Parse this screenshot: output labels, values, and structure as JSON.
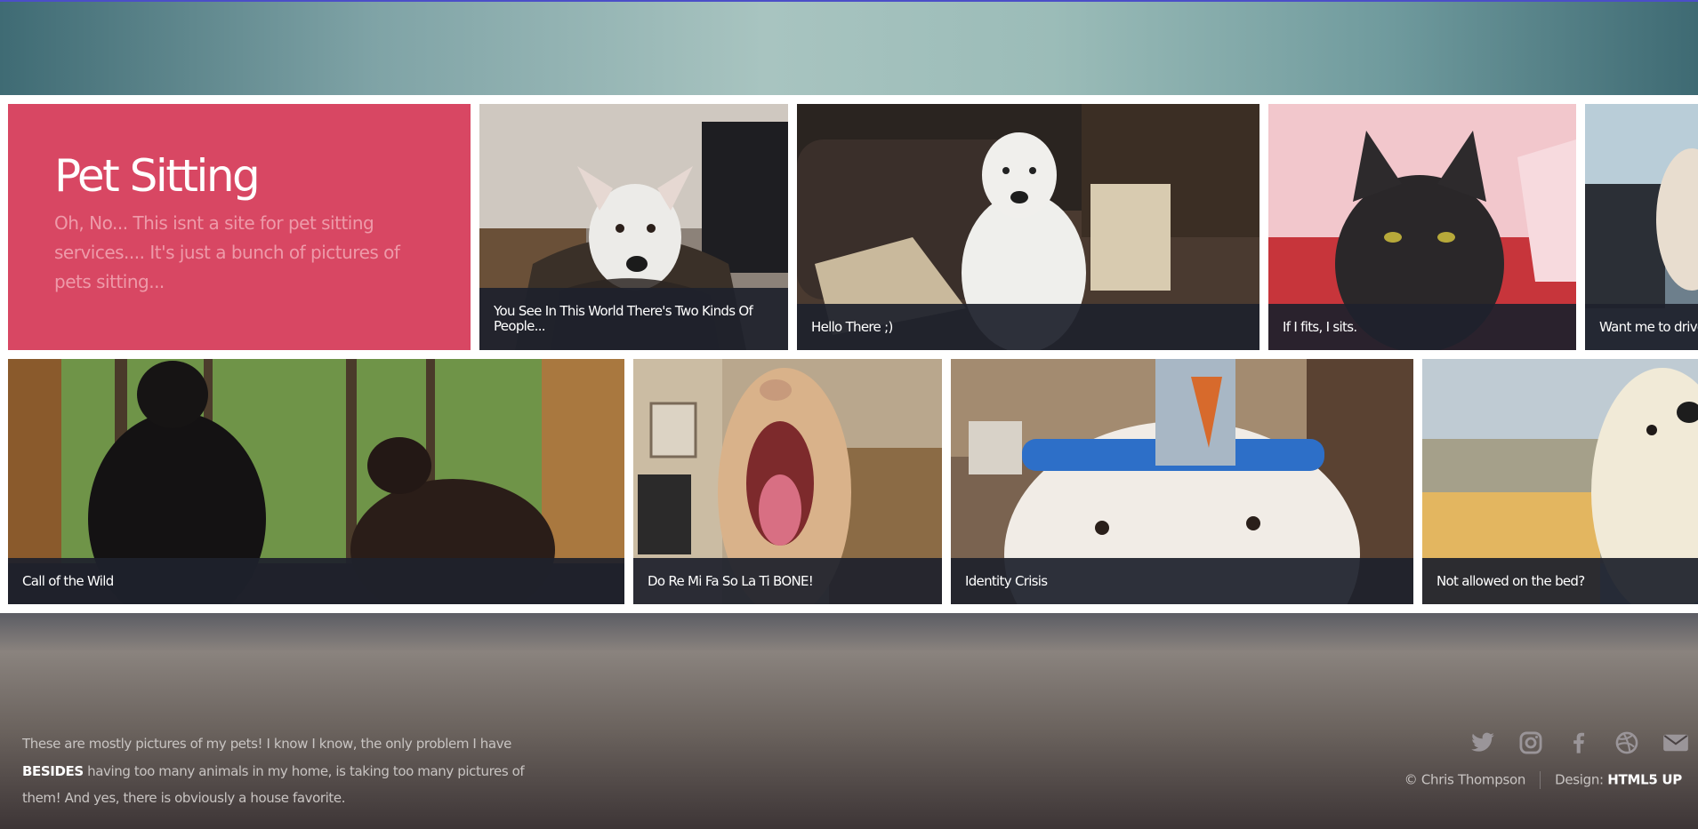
{
  "intro": {
    "title": "Pet Sitting",
    "text": "Oh, No... This isnt a site for pet sitting services.... It's just a bunch of pictures of pets sitting..."
  },
  "gallery": {
    "row1": [
      {
        "caption": "You See In This World There's Two Kinds Of People...",
        "photo": "white-dog-on-scarf"
      },
      {
        "caption": "Hello There ;)",
        "photo": "white-dog-sitting-on-sofa"
      },
      {
        "caption": "If I fits, I sits.",
        "photo": "black-cat-in-red-sink"
      },
      {
        "caption": "Want me to drive",
        "photo": "dog-in-car"
      }
    ],
    "row2": [
      {
        "caption": "Call of the Wild",
        "photo": "two-cats-at-window"
      },
      {
        "caption": "Do Re Mi Fa So La Ti BONE!",
        "photo": "dog-yawning"
      },
      {
        "caption": "Identity Crisis",
        "photo": "dog-with-carrot-headband"
      },
      {
        "caption": "Not allowed on the bed?",
        "photo": "dog-on-bed"
      }
    ]
  },
  "footer": {
    "about_part1": "These are mostly pictures of my pets! I know I know, the only problem I have ",
    "about_bold": "BESIDES",
    "about_part2": " having too many animals in my home, is taking too many pictures of them! And yes, there is obviously a house favorite.",
    "socials": [
      {
        "name": "twitter-icon"
      },
      {
        "name": "instagram-icon"
      },
      {
        "name": "facebook-icon"
      },
      {
        "name": "dribbble-icon"
      },
      {
        "name": "email-icon"
      }
    ],
    "copyright": "© Chris Thompson",
    "design_label": "Design: ",
    "design_credit": "HTML5 UP"
  },
  "colors": {
    "accent": "#d84763",
    "caption_bg": "#1e212c",
    "header_teal": "#9bbcb8"
  }
}
